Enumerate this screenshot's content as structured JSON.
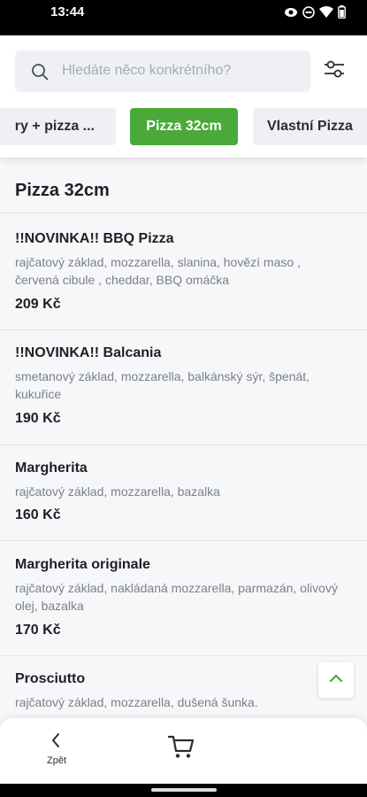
{
  "status_bar": {
    "time": "13:44",
    "icons": [
      "eye-icon",
      "do-not-disturb-icon",
      "wifi-icon",
      "battery-icon"
    ]
  },
  "search": {
    "placeholder": "Hledáte něco konkrétního?"
  },
  "tabs": [
    {
      "label": "ry + pizza ...",
      "active": false
    },
    {
      "label": "Pizza 32cm",
      "active": true
    },
    {
      "label": "Vlastní Pizza",
      "active": false
    }
  ],
  "category_title": "Pizza 32cm",
  "items": [
    {
      "name": "!!NOVINKA!! BBQ Pizza",
      "description": "rajčatový základ, mozzarella, slanina, hovězí maso , červená cibule , cheddar, BBQ omáčka",
      "price": "209 Kč"
    },
    {
      "name": "!!NOVINKA!! Balcania",
      "description": "smetanový základ, mozzarella, balkánský sýr, špenát, kukuřice",
      "price": "190 Kč"
    },
    {
      "name": "Margherita",
      "description": "rajčatový základ, mozzarella, bazalka",
      "price": "160 Kč"
    },
    {
      "name": "Margherita originale",
      "description": "rajčatový základ, nakládaná mozzarella, parmazán, olivový olej, bazalka",
      "price": "170 Kč"
    },
    {
      "name": "Prosciutto",
      "description": "rajčatový základ, mozzarella, dušená šunka."
    }
  ],
  "bottom_nav": {
    "back_label": "Zpět"
  },
  "colors": {
    "accent": "#4ba93a",
    "text": "#1d2025",
    "muted": "#7b8089",
    "background": "#f6f7f9"
  }
}
